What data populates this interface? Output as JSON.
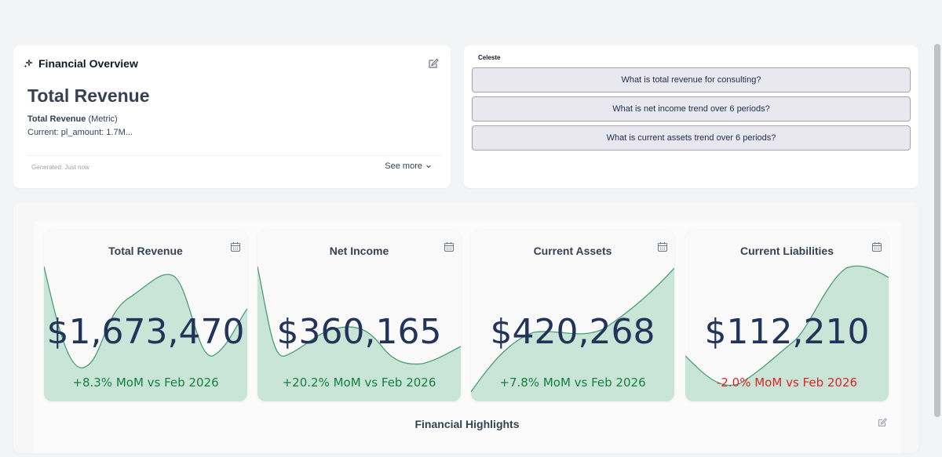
{
  "overview": {
    "title": "Financial Overview",
    "heading": "Total Revenue",
    "metric_name": "Total Revenue",
    "metric_type": "(Metric)",
    "current_line": "Current: pl_amount: 1.7M...",
    "generated": "Generated: Just now",
    "see_more": "See more"
  },
  "chat": {
    "assistant_name": "Celeste",
    "suggestions": [
      "What is total revenue for consulting?",
      "What is net income trend over 6 periods?",
      "What is current assets trend over 6 periods?"
    ]
  },
  "kpis": [
    {
      "title": "Total Revenue",
      "value": "$1,673,470",
      "delta": "+8.3% MoM vs Feb 2026",
      "delta_color": "#15803d",
      "icon": "calendar-icon"
    },
    {
      "title": "Net Income",
      "value": "$360,165",
      "delta": "+20.2% MoM vs Feb 2026",
      "delta_color": "#15803d",
      "icon": "calendar-icon"
    },
    {
      "title": "Current Assets",
      "value": "$420,268",
      "delta": "+7.8% MoM vs Feb 2026",
      "delta_color": "#15803d",
      "icon": "calendar-icon"
    },
    {
      "title": "Current Liabilities",
      "value": "$112,210",
      "delta": "-2.0% MoM vs Feb 2026",
      "delta_color": "#dc2626",
      "icon": "calendar-icon"
    }
  ],
  "highlights": {
    "title": "Financial Highlights"
  },
  "colors": {
    "sparkline_fill": "#c9e5d8",
    "sparkline_stroke": "#4a9c7a",
    "accent_text": "#22345a"
  }
}
